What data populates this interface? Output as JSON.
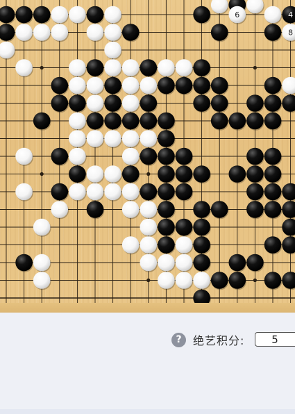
{
  "board": {
    "size": 19,
    "background": "#e8c586",
    "line_color": "#2a2014",
    "black_stone_color": "#111111",
    "white_stone_color": "#f5f5f5",
    "stones": [
      {
        "c": "b",
        "col": 0,
        "row": 0
      },
      {
        "c": "b",
        "col": 1,
        "row": 0
      },
      {
        "c": "b",
        "col": 2,
        "row": 0
      },
      {
        "c": "w",
        "col": 3,
        "row": 0
      },
      {
        "c": "w",
        "col": 4,
        "row": 0
      },
      {
        "c": "b",
        "col": 5,
        "row": 0
      },
      {
        "c": "w",
        "col": 6,
        "row": 0
      },
      {
        "c": "b",
        "col": 11,
        "row": 0
      },
      {
        "c": "w",
        "col": 13,
        "row": 0,
        "label": "6"
      },
      {
        "c": "w",
        "col": 15,
        "row": 0
      },
      {
        "c": "b",
        "col": 16,
        "row": 0,
        "label": "4"
      },
      {
        "c": "b",
        "col": 0,
        "row": 1
      },
      {
        "c": "w",
        "col": 1,
        "row": 1
      },
      {
        "c": "w",
        "col": 2,
        "row": 1
      },
      {
        "c": "w",
        "col": 3,
        "row": 1
      },
      {
        "c": "w",
        "col": 5,
        "row": 1
      },
      {
        "c": "w",
        "col": 6,
        "row": 1
      },
      {
        "c": "b",
        "col": 7,
        "row": 1
      },
      {
        "c": "b",
        "col": 12,
        "row": 1
      },
      {
        "c": "b",
        "col": 15,
        "row": 1
      },
      {
        "c": "w",
        "col": 16,
        "row": 1,
        "label": "8"
      },
      {
        "c": "w",
        "col": 0,
        "row": 2
      },
      {
        "c": "w",
        "col": 6,
        "row": 2
      },
      {
        "c": "w",
        "col": 1,
        "row": 3
      },
      {
        "c": "w",
        "col": 4,
        "row": 3
      },
      {
        "c": "b",
        "col": 5,
        "row": 3
      },
      {
        "c": "w",
        "col": 6,
        "row": 3
      },
      {
        "c": "w",
        "col": 7,
        "row": 3
      },
      {
        "c": "b",
        "col": 8,
        "row": 3
      },
      {
        "c": "w",
        "col": 9,
        "row": 3
      },
      {
        "c": "w",
        "col": 10,
        "row": 3
      },
      {
        "c": "b",
        "col": 11,
        "row": 3
      },
      {
        "c": "b",
        "col": 3,
        "row": 4
      },
      {
        "c": "w",
        "col": 4,
        "row": 4
      },
      {
        "c": "w",
        "col": 5,
        "row": 4
      },
      {
        "c": "b",
        "col": 6,
        "row": 4
      },
      {
        "c": "w",
        "col": 7,
        "row": 4
      },
      {
        "c": "w",
        "col": 8,
        "row": 4
      },
      {
        "c": "b",
        "col": 9,
        "row": 4
      },
      {
        "c": "b",
        "col": 10,
        "row": 4
      },
      {
        "c": "b",
        "col": 11,
        "row": 4
      },
      {
        "c": "b",
        "col": 12,
        "row": 4
      },
      {
        "c": "b",
        "col": 15,
        "row": 4
      },
      {
        "c": "w",
        "col": 16,
        "row": 4
      },
      {
        "c": "b",
        "col": 3,
        "row": 5
      },
      {
        "c": "b",
        "col": 4,
        "row": 5
      },
      {
        "c": "w",
        "col": 5,
        "row": 5
      },
      {
        "c": "b",
        "col": 6,
        "row": 5
      },
      {
        "c": "w",
        "col": 7,
        "row": 5
      },
      {
        "c": "b",
        "col": 8,
        "row": 5
      },
      {
        "c": "b",
        "col": 11,
        "row": 5
      },
      {
        "c": "b",
        "col": 12,
        "row": 5
      },
      {
        "c": "b",
        "col": 14,
        "row": 5
      },
      {
        "c": "b",
        "col": 15,
        "row": 5
      },
      {
        "c": "b",
        "col": 16,
        "row": 5
      },
      {
        "c": "b",
        "col": 2,
        "row": 6
      },
      {
        "c": "w",
        "col": 4,
        "row": 6
      },
      {
        "c": "b",
        "col": 5,
        "row": 6
      },
      {
        "c": "b",
        "col": 6,
        "row": 6
      },
      {
        "c": "b",
        "col": 7,
        "row": 6
      },
      {
        "c": "b",
        "col": 8,
        "row": 6
      },
      {
        "c": "b",
        "col": 9,
        "row": 6
      },
      {
        "c": "b",
        "col": 12,
        "row": 6
      },
      {
        "c": "b",
        "col": 13,
        "row": 6
      },
      {
        "c": "b",
        "col": 14,
        "row": 6
      },
      {
        "c": "b",
        "col": 15,
        "row": 6
      },
      {
        "c": "w",
        "col": 4,
        "row": 7
      },
      {
        "c": "w",
        "col": 5,
        "row": 7
      },
      {
        "c": "w",
        "col": 6,
        "row": 7
      },
      {
        "c": "w",
        "col": 7,
        "row": 7
      },
      {
        "c": "w",
        "col": 8,
        "row": 7
      },
      {
        "c": "b",
        "col": 9,
        "row": 7
      },
      {
        "c": "w",
        "col": 1,
        "row": 8
      },
      {
        "c": "b",
        "col": 3,
        "row": 8
      },
      {
        "c": "w",
        "col": 4,
        "row": 8
      },
      {
        "c": "w",
        "col": 7,
        "row": 8
      },
      {
        "c": "b",
        "col": 8,
        "row": 8
      },
      {
        "c": "b",
        "col": 9,
        "row": 8
      },
      {
        "c": "b",
        "col": 10,
        "row": 8
      },
      {
        "c": "b",
        "col": 14,
        "row": 8
      },
      {
        "c": "b",
        "col": 15,
        "row": 8
      },
      {
        "c": "b",
        "col": 4,
        "row": 9
      },
      {
        "c": "w",
        "col": 5,
        "row": 9
      },
      {
        "c": "w",
        "col": 6,
        "row": 9
      },
      {
        "c": "b",
        "col": 7,
        "row": 9
      },
      {
        "c": "b",
        "col": 9,
        "row": 9
      },
      {
        "c": "b",
        "col": 10,
        "row": 9
      },
      {
        "c": "b",
        "col": 11,
        "row": 9
      },
      {
        "c": "b",
        "col": 13,
        "row": 9
      },
      {
        "c": "b",
        "col": 14,
        "row": 9
      },
      {
        "c": "b",
        "col": 15,
        "row": 9
      },
      {
        "c": "w",
        "col": 1,
        "row": 10
      },
      {
        "c": "b",
        "col": 3,
        "row": 10
      },
      {
        "c": "w",
        "col": 4,
        "row": 10
      },
      {
        "c": "w",
        "col": 5,
        "row": 10
      },
      {
        "c": "w",
        "col": 6,
        "row": 10
      },
      {
        "c": "w",
        "col": 7,
        "row": 10
      },
      {
        "c": "b",
        "col": 8,
        "row": 10
      },
      {
        "c": "b",
        "col": 9,
        "row": 10
      },
      {
        "c": "b",
        "col": 10,
        "row": 10
      },
      {
        "c": "b",
        "col": 14,
        "row": 10
      },
      {
        "c": "b",
        "col": 15,
        "row": 10
      },
      {
        "c": "b",
        "col": 16,
        "row": 10
      },
      {
        "c": "w",
        "col": 3,
        "row": 11
      },
      {
        "c": "b",
        "col": 5,
        "row": 11
      },
      {
        "c": "w",
        "col": 7,
        "row": 11
      },
      {
        "c": "w",
        "col": 8,
        "row": 11
      },
      {
        "c": "b",
        "col": 9,
        "row": 11
      },
      {
        "c": "b",
        "col": 11,
        "row": 11
      },
      {
        "c": "b",
        "col": 12,
        "row": 11
      },
      {
        "c": "b",
        "col": 14,
        "row": 11
      },
      {
        "c": "b",
        "col": 15,
        "row": 11
      },
      {
        "c": "b",
        "col": 16,
        "row": 11
      },
      {
        "c": "w",
        "col": 2,
        "row": 12
      },
      {
        "c": "w",
        "col": 8,
        "row": 12
      },
      {
        "c": "b",
        "col": 9,
        "row": 12
      },
      {
        "c": "b",
        "col": 10,
        "row": 12
      },
      {
        "c": "b",
        "col": 11,
        "row": 12
      },
      {
        "c": "b",
        "col": 16,
        "row": 12
      },
      {
        "c": "w",
        "col": 7,
        "row": 13
      },
      {
        "c": "w",
        "col": 8,
        "row": 13
      },
      {
        "c": "b",
        "col": 9,
        "row": 13
      },
      {
        "c": "w",
        "col": 10,
        "row": 13
      },
      {
        "c": "b",
        "col": 11,
        "row": 13
      },
      {
        "c": "b",
        "col": 15,
        "row": 13
      },
      {
        "c": "b",
        "col": 16,
        "row": 13
      },
      {
        "c": "b",
        "col": 1,
        "row": 14
      },
      {
        "c": "w",
        "col": 2,
        "row": 14
      },
      {
        "c": "w",
        "col": 8,
        "row": 14
      },
      {
        "c": "w",
        "col": 9,
        "row": 14
      },
      {
        "c": "w",
        "col": 10,
        "row": 14
      },
      {
        "c": "b",
        "col": 11,
        "row": 14
      },
      {
        "c": "b",
        "col": 13,
        "row": 14
      },
      {
        "c": "b",
        "col": 14,
        "row": 14
      },
      {
        "c": "w",
        "col": 2,
        "row": 15
      },
      {
        "c": "w",
        "col": 9,
        "row": 15
      },
      {
        "c": "w",
        "col": 10,
        "row": 15
      },
      {
        "c": "w",
        "col": 11,
        "row": 15
      },
      {
        "c": "b",
        "col": 12,
        "row": 15
      },
      {
        "c": "b",
        "col": 13,
        "row": 15
      },
      {
        "c": "b",
        "col": 15,
        "row": 15
      },
      {
        "c": "b",
        "col": 16,
        "row": 15
      },
      {
        "c": "b",
        "col": 11,
        "row": 16
      }
    ],
    "star_points": [
      [
        2,
        3
      ],
      [
        2,
        9
      ],
      [
        2,
        15
      ],
      [
        8,
        3
      ],
      [
        8,
        9
      ],
      [
        8,
        15
      ],
      [
        14,
        3
      ],
      [
        14,
        9
      ],
      [
        14,
        15
      ]
    ],
    "top_row_fragments": [
      {
        "c": "w",
        "col": 12,
        "label": ""
      },
      {
        "c": "b",
        "col": 13,
        "label": ""
      },
      {
        "c": "w",
        "col": 14,
        "label": ""
      }
    ]
  },
  "panel": {
    "help_icon": "question-circle-icon",
    "help_symbol": "?",
    "score_label": "绝艺积分:",
    "score_value": "5"
  }
}
